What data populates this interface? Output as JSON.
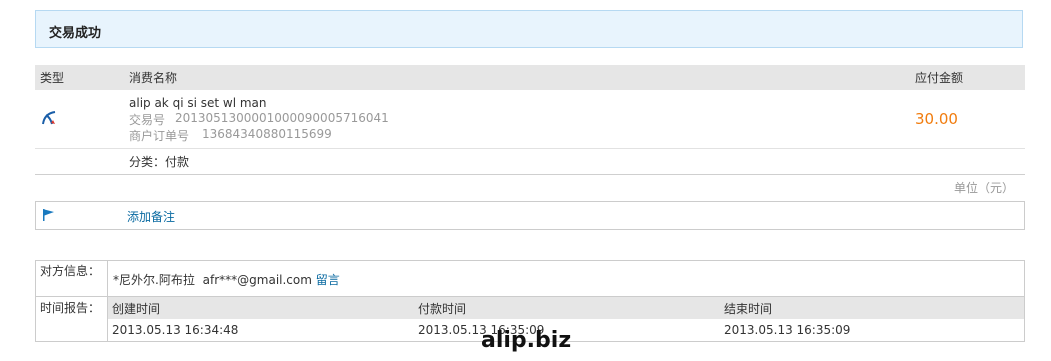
{
  "status": {
    "title": "交易成功"
  },
  "table": {
    "headers": {
      "type": "类型",
      "name": "消费名称",
      "amount": "应付金额"
    },
    "item": {
      "name": "alip ak qi si set wl man",
      "trade_no_label": "交易号",
      "trade_no": "2013051300001000090005716041",
      "order_no_label": "商户订单号",
      "order_no": "13684340880115699",
      "amount": "30.00",
      "category": "分类：付款"
    },
    "unit": "单位（元）"
  },
  "notes": {
    "add_label": "添加备注"
  },
  "counterparty": {
    "label": "对方信息：",
    "name": "*尼外尔.阿布拉",
    "email": "afr***@gmail.com",
    "message_link": "留言"
  },
  "timeline": {
    "label": "时间报告：",
    "created_label": "创建时间",
    "paid_label": "付款时间",
    "ended_label": "结束时间",
    "created": "2013.05.13 16:34:48",
    "paid": "2013.05.13 16:35:09",
    "ended": "2013.05.13 16:35:09"
  },
  "watermark": "alip.biz",
  "colors": {
    "amount": "#f17c0e",
    "link": "#0a6aa1",
    "status_bg": "#e8f4fd"
  },
  "icons": {
    "type_icon": "transfer-swirl-icon",
    "note_icon": "flag-icon"
  }
}
